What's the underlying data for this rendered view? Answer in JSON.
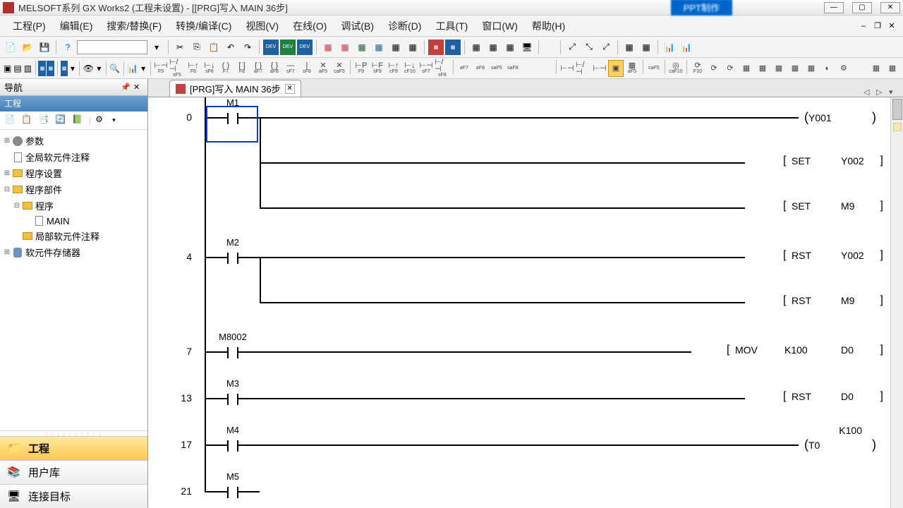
{
  "title": "MELSOFT系列 GX Works2 (工程未设置) - [[PRG]写入 MAIN 36步]",
  "ppt_badge": "PPT制作",
  "menus": [
    "工程(P)",
    "编辑(E)",
    "搜索/替换(F)",
    "转换/编译(C)",
    "视图(V)",
    "在线(O)",
    "调试(B)",
    "诊断(D)",
    "工具(T)",
    "窗口(W)",
    "帮助(H)"
  ],
  "sidebar": {
    "title": "导航",
    "section": "工程",
    "tree": [
      {
        "label": "参数",
        "indent": 0,
        "exp": "⊞",
        "icon": "gear"
      },
      {
        "label": "全局软元件注释",
        "indent": 0,
        "exp": "",
        "icon": "file"
      },
      {
        "label": "程序设置",
        "indent": 0,
        "exp": "⊞",
        "icon": "folder"
      },
      {
        "label": "程序部件",
        "indent": 0,
        "exp": "⊟",
        "icon": "folder"
      },
      {
        "label": "程序",
        "indent": 1,
        "exp": "⊟",
        "icon": "folder"
      },
      {
        "label": "MAIN",
        "indent": 2,
        "exp": "",
        "icon": "file"
      },
      {
        "label": "局部软元件注释",
        "indent": 1,
        "exp": "",
        "icon": "folder"
      },
      {
        "label": "软元件存储器",
        "indent": 0,
        "exp": "⊞",
        "icon": "db"
      }
    ],
    "categories": [
      {
        "label": "工程",
        "active": true
      },
      {
        "label": "用户库",
        "active": false
      },
      {
        "label": "连接目标",
        "active": false
      }
    ]
  },
  "tab": {
    "label": "[PRG]写入 MAIN 36步"
  },
  "toolbar2_labels": [
    "F5",
    "sF5",
    "F6",
    "sF6",
    "F7",
    "F8",
    "aF7",
    "aF8",
    "sF7",
    "sF8",
    "aF5",
    "caF5",
    "F9",
    "sF9",
    "cF9",
    "cF10",
    "sF7",
    "sF8",
    "aF7",
    "aF8",
    "saF5",
    "saF8",
    "",
    "",
    "",
    "",
    "",
    "",
    "aF5",
    "caF5",
    "caF10",
    "F10",
    "",
    "",
    "",
    "",
    "",
    "",
    "",
    "",
    "",
    "",
    "",
    "",
    "",
    ""
  ],
  "ladder": {
    "rungs": [
      {
        "step": 0,
        "contact": "M1",
        "outputs": [
          {
            "type": "coil",
            "text": "Y001"
          },
          {
            "type": "instr",
            "op": "SET",
            "args": [
              "Y002"
            ]
          },
          {
            "type": "instr",
            "op": "SET",
            "args": [
              "M9"
            ]
          }
        ]
      },
      {
        "step": 4,
        "contact": "M2",
        "outputs": [
          {
            "type": "instr",
            "op": "RST",
            "args": [
              "Y002"
            ]
          },
          {
            "type": "instr",
            "op": "RST",
            "args": [
              "M9"
            ]
          }
        ]
      },
      {
        "step": 7,
        "contact": "M8002",
        "outputs": [
          {
            "type": "instr",
            "op": "MOV",
            "args": [
              "K100",
              "D0"
            ]
          }
        ]
      },
      {
        "step": 13,
        "contact": "M3",
        "outputs": [
          {
            "type": "instr",
            "op": "RST",
            "args": [
              "D0"
            ]
          }
        ]
      },
      {
        "step": 17,
        "contact": "M4",
        "extra_label": "K100",
        "outputs": [
          {
            "type": "coil",
            "text": "T0"
          }
        ]
      },
      {
        "step": 21,
        "contact": "M5",
        "outputs": []
      }
    ]
  }
}
